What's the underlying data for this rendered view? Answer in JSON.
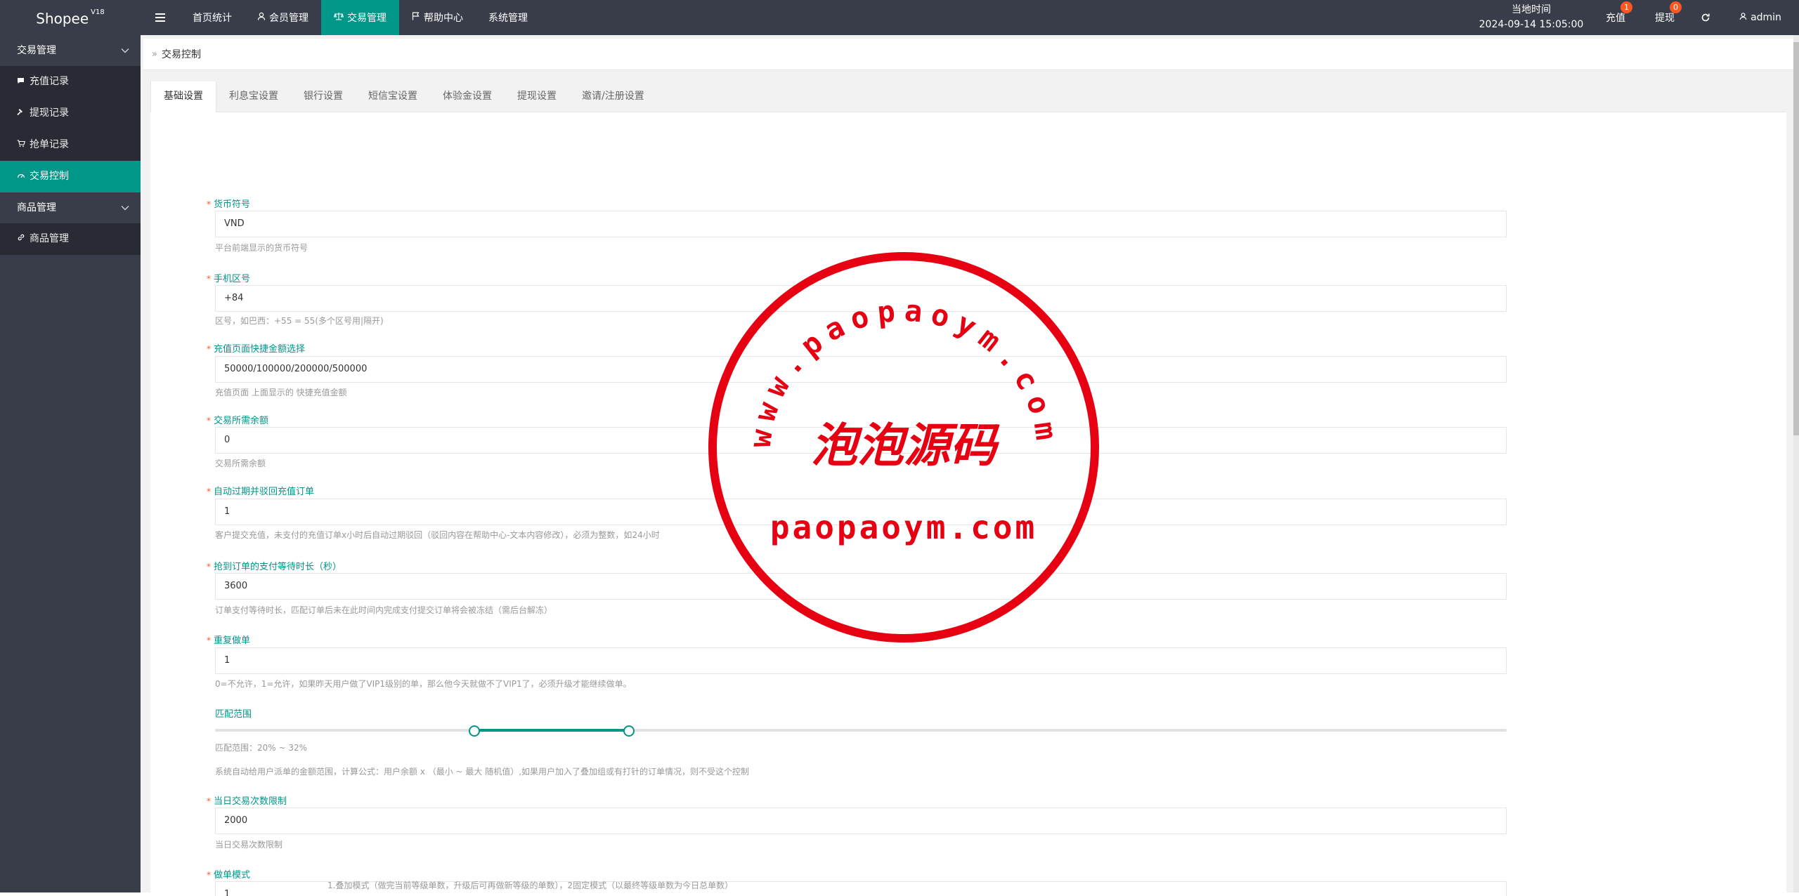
{
  "app": {
    "logo": "Shopee",
    "version": "V18"
  },
  "topnav": {
    "items": [
      {
        "label": "首页统计",
        "icon": ""
      },
      {
        "label": "会员管理",
        "icon": "user-icon"
      },
      {
        "label": "交易管理",
        "icon": "scale-icon",
        "active": true
      },
      {
        "label": "帮助中心",
        "icon": "flag-icon"
      },
      {
        "label": "系统管理",
        "icon": ""
      }
    ]
  },
  "topright": {
    "time_label": "当地时间",
    "time_value": "2024-09-14 15:05:00",
    "recharge_label": "充值",
    "recharge_badge": "1",
    "withdraw_label": "提现",
    "withdraw_badge": "0",
    "user_label": "admin"
  },
  "sidebar": {
    "group1": "交易管理",
    "items1": [
      {
        "label": "充值记录",
        "icon": "chat-icon"
      },
      {
        "label": "提现记录",
        "icon": "hammer-icon"
      },
      {
        "label": "抢单记录",
        "icon": "cart-icon"
      },
      {
        "label": "交易控制",
        "icon": "gauge-icon",
        "active": true
      }
    ],
    "group2": "商品管理",
    "items2": [
      {
        "label": "商品管理",
        "icon": "link-icon"
      }
    ]
  },
  "breadcrumb": {
    "current": "交易控制"
  },
  "tabs": [
    "基础设置",
    "利息宝设置",
    "银行设置",
    "短信宝设置",
    "体验金设置",
    "提现设置",
    "邀请/注册设置"
  ],
  "form": {
    "currency": {
      "label": "货币符号",
      "value": "VND",
      "help": "平台前端显示的货币符号"
    },
    "phone_code": {
      "label": "手机区号",
      "value": "+84",
      "help": "区号，如巴西：+55 = 55(多个区号用|隔开)"
    },
    "quick_amounts": {
      "label": "充值页面快捷金额选择",
      "value": "50000/100000/200000/500000",
      "help": "充值页面 上面显示的 快捷充值金额"
    },
    "min_balance": {
      "label": "交易所需余额",
      "value": "0",
      "help": "交易所需余额"
    },
    "auto_expire": {
      "label": "自动过期并驳回充值订单",
      "value": "1",
      "help": "客户提交充值，未支付的充值订单x小时后自动过期驳回（驳回内容在帮助中心-文本内容修改），必须为整数，如24小时"
    },
    "pay_wait": {
      "label": "抢到订单的支付等待时长（秒）",
      "value": "3600",
      "help": "订单支付等待时长，匹配订单后未在此时间内完成支付提交订单将会被冻结（需后台解冻）"
    },
    "repeat_order": {
      "label": "重复做单",
      "value": "1",
      "help": "0=不允许，1=允许，如果昨天用户做了VIP1级别的单，那么他今天就做不了VIP1了，必须升级才能继续做单。"
    },
    "match_range": {
      "label": "匹配范围",
      "min": 20,
      "max": 32,
      "value_text": "匹配范围：20% ~ 32%",
      "help": "系统自动给用户派单的金额范围，计算公式：用户余额 x （最小 ~ 最大 随机值）,如果用户加入了叠加组或有打针的订单情况，则不受这个控制"
    },
    "daily_limit": {
      "label": "当日交易次数限制",
      "value": "2000",
      "help": "当日交易次数限制"
    },
    "order_mode": {
      "label": "做单模式",
      "value": "1",
      "help": "1.叠加模式（做完当前等级单数，升级后可再做新等级的单数），2固定模式（以最终等级单数为今日总单数）"
    }
  },
  "watermark": {
    "url_top": "www.paopaoym.com",
    "chinese": "泡泡源码",
    "url_bottom": "paopaoym.com",
    "color": "#e60012"
  },
  "colors": {
    "accent": "#009688",
    "nav_bg": "#393d49",
    "side_dark": "#282b33",
    "badge": "#ff5722"
  }
}
